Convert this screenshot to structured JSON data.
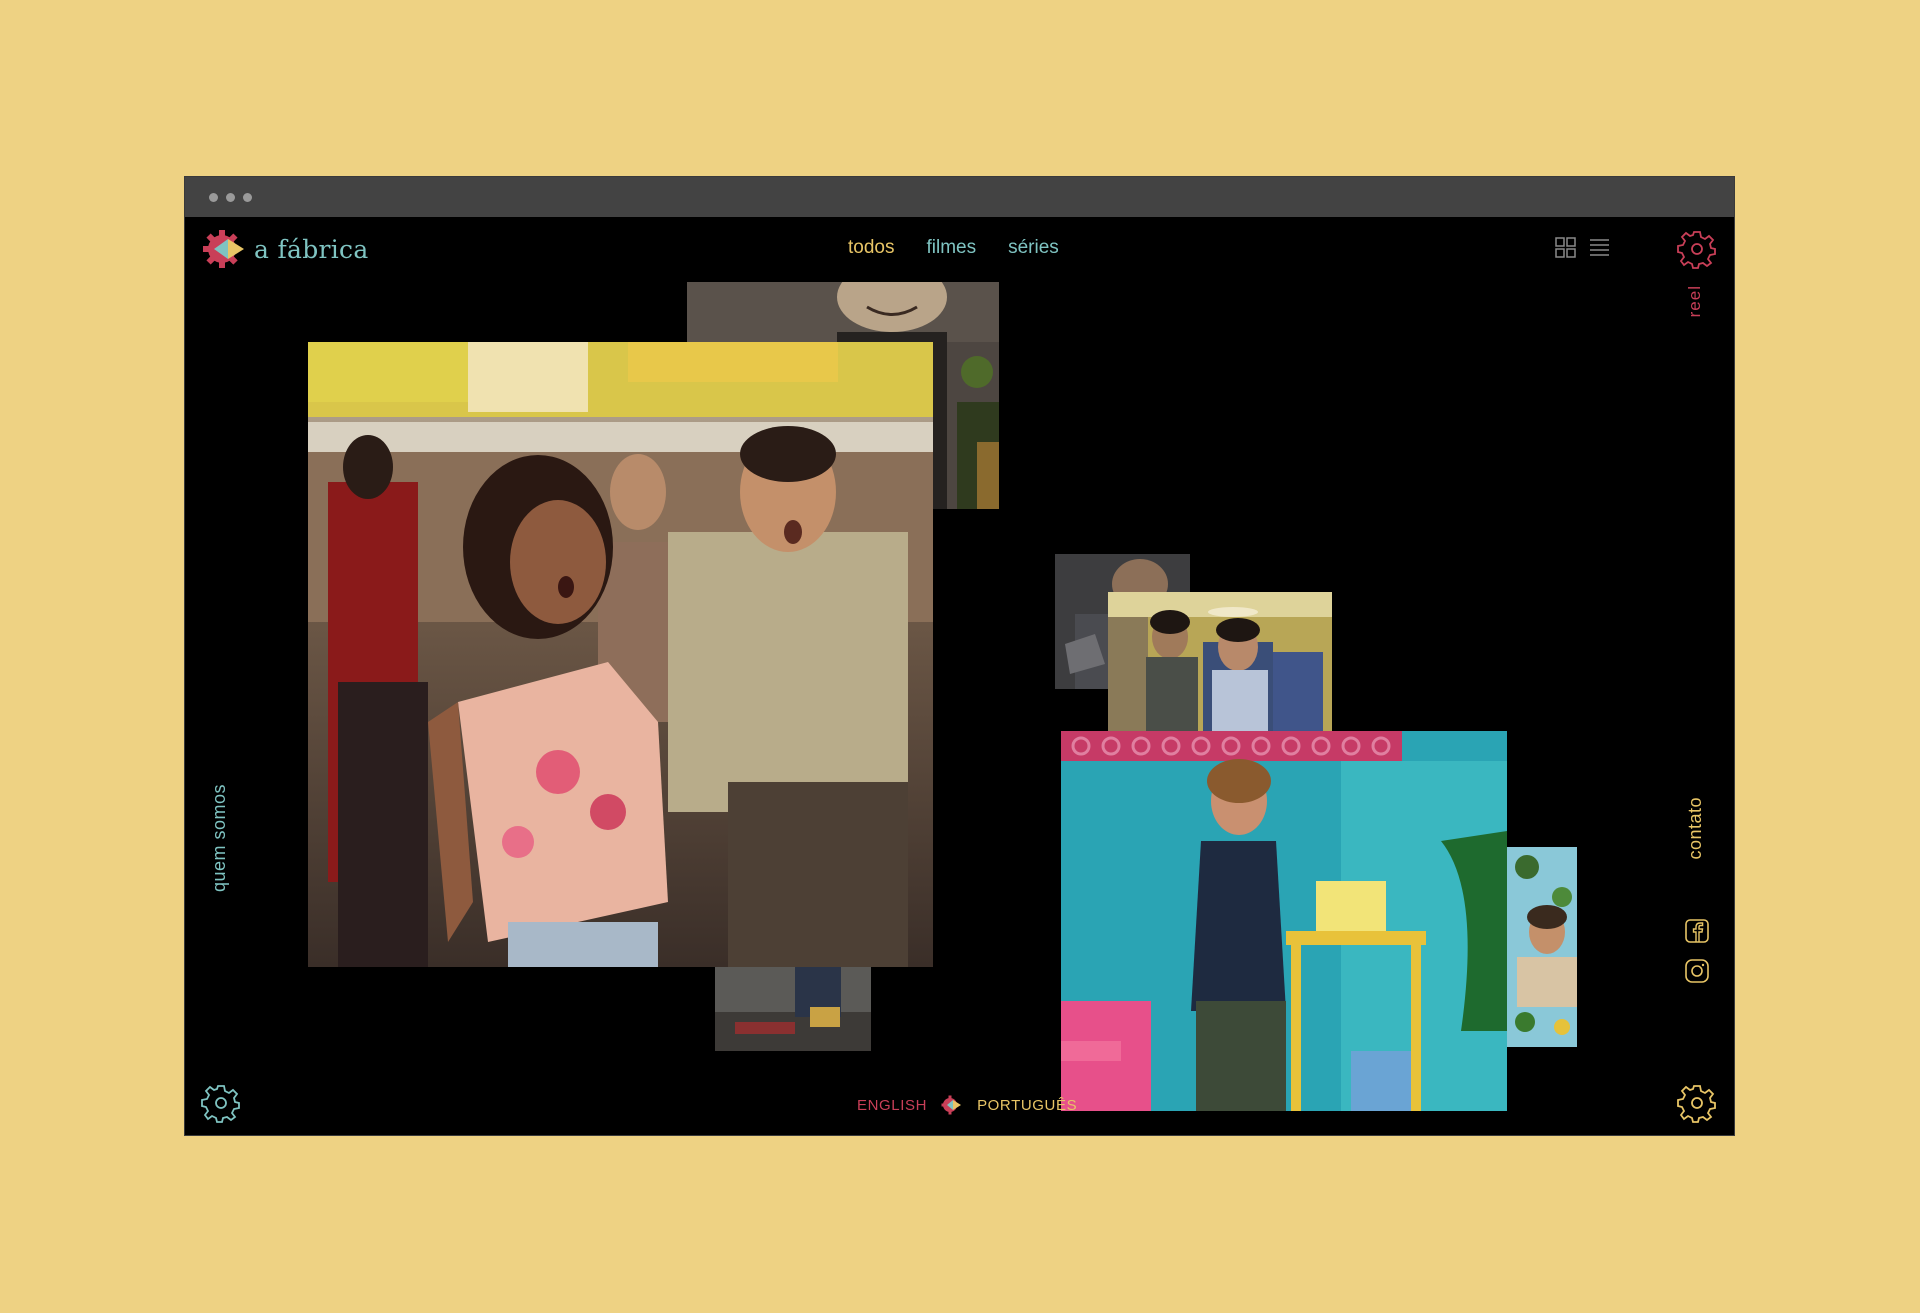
{
  "brand": {
    "name": "a fábrica"
  },
  "nav": [
    {
      "label": "todos",
      "active": true
    },
    {
      "label": "filmes",
      "active": false
    },
    {
      "label": "séries",
      "active": false
    }
  ],
  "side": {
    "reel": "reel",
    "quem_somos": "quem somos",
    "contato": "contato"
  },
  "language": {
    "english": "ENGLISH",
    "portugues": "PORTUGUÊS"
  },
  "icons": [
    "logo-gear-icon",
    "grid-view-icon",
    "list-view-icon",
    "gear-icon",
    "facebook-icon",
    "instagram-icon"
  ],
  "colors": {
    "background": "#eed283",
    "teal": "#7fc4c2",
    "yellow": "#e8c566",
    "red": "#c93f58"
  }
}
